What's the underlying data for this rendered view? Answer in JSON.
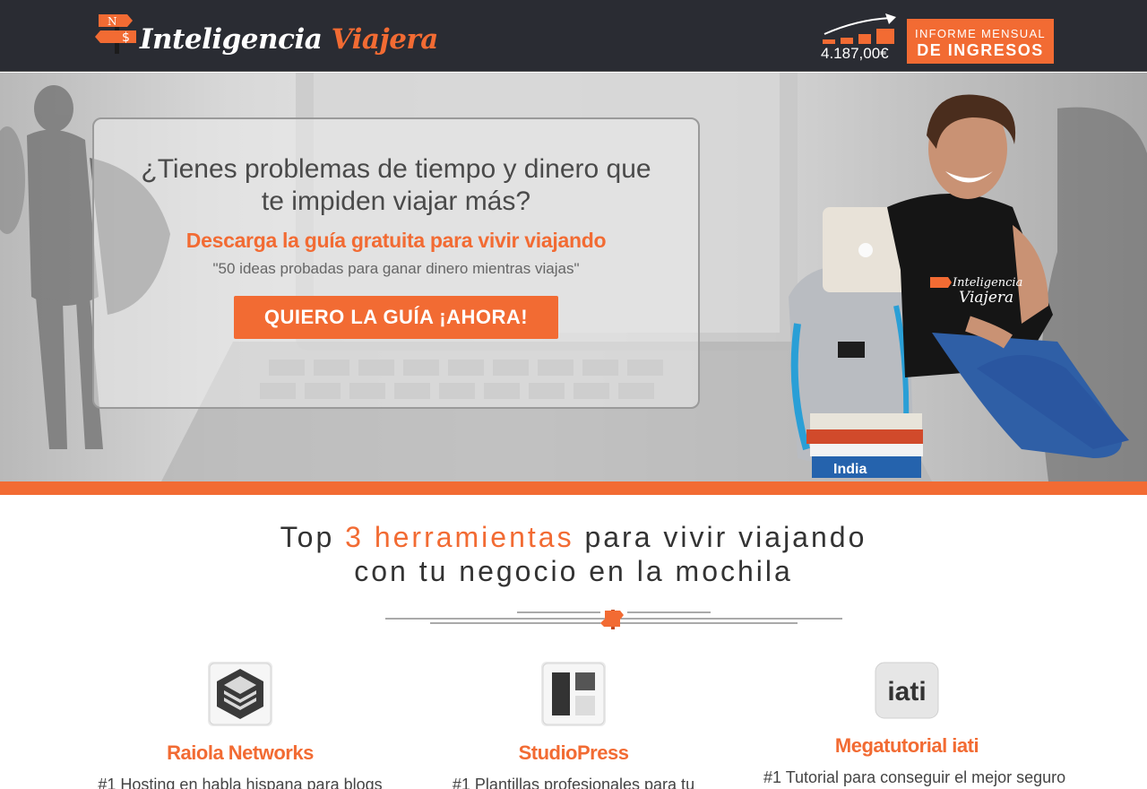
{
  "header": {
    "logo": {
      "text_main": "Inteligencia",
      "text_accent": "Viajera",
      "sign_top": "N",
      "sign_bottom": "$"
    },
    "income": {
      "amount": "4.187,00€",
      "button_line1": "INFORME MENSUAL",
      "button_line2": "DE INGRESOS"
    }
  },
  "hero": {
    "title": "¿Tienes problemas de tiempo y dinero que te impiden viajar más?",
    "subtitle": "Descarga la guía gratuita para vivir viajando",
    "quote": "\"50 ideas probadas para ganar dinero mientras viajas\"",
    "cta": "QUIERO LA GUÍA ¡AHORA!",
    "shirt_text": "Inteligencia Viajera",
    "book_label": "India"
  },
  "tools": {
    "title_pre": "Top ",
    "title_highlight": "3 herramientas",
    "title_post": " para vivir viajando",
    "title_line2": "con tu negocio en la mochila",
    "items": [
      {
        "name": "Raiola Networks",
        "desc": "#1 Hosting en habla hispana para blogs",
        "icon": "server-stack-icon"
      },
      {
        "name": "StudioPress",
        "desc": "#1 Plantillas profesionales para tu",
        "icon": "layout-icon"
      },
      {
        "name": "Megatutorial iati",
        "desc": "#1 Tutorial para conseguir el mejor seguro",
        "icon": "iati-logo",
        "icon_text": "iati"
      }
    ]
  },
  "colors": {
    "accent": "#f26b33",
    "header_bg": "#2a2c33"
  }
}
